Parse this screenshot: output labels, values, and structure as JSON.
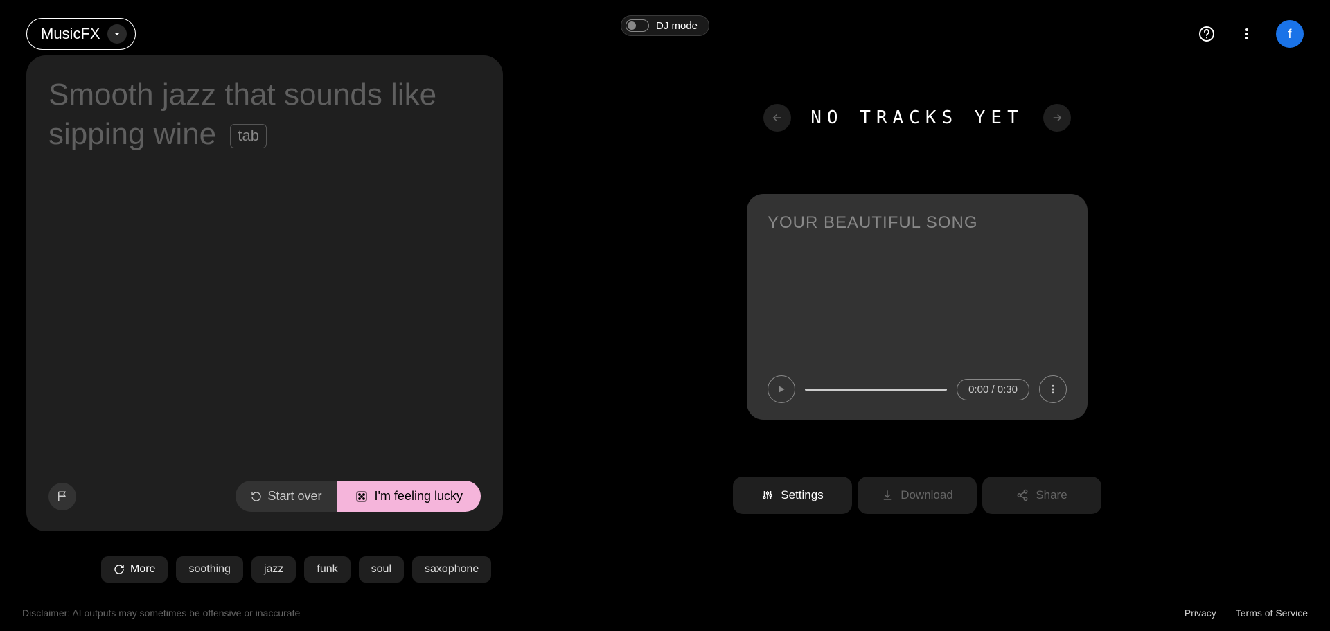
{
  "header": {
    "app_name": "MusicFX",
    "dj_mode_label": "DJ mode",
    "avatar_letter": "f"
  },
  "prompt": {
    "placeholder": "Smooth jazz that sounds like sipping wine",
    "tab_hint": "tab",
    "start_over_label": "Start over",
    "lucky_label": "I'm feeling lucky"
  },
  "chips": {
    "more_label": "More",
    "items": [
      "soothing",
      "jazz",
      "funk",
      "soul",
      "saxophone"
    ]
  },
  "tracks": {
    "title": "NO TRACKS YET",
    "card_title": "YOUR BEAUTIFUL SONG",
    "time": "0:00 / 0:30"
  },
  "actions": {
    "settings_label": "Settings",
    "download_label": "Download",
    "share_label": "Share"
  },
  "footer": {
    "disclaimer": "Disclaimer: AI outputs may sometimes be offensive or inaccurate",
    "privacy": "Privacy",
    "terms": "Terms of Service"
  }
}
